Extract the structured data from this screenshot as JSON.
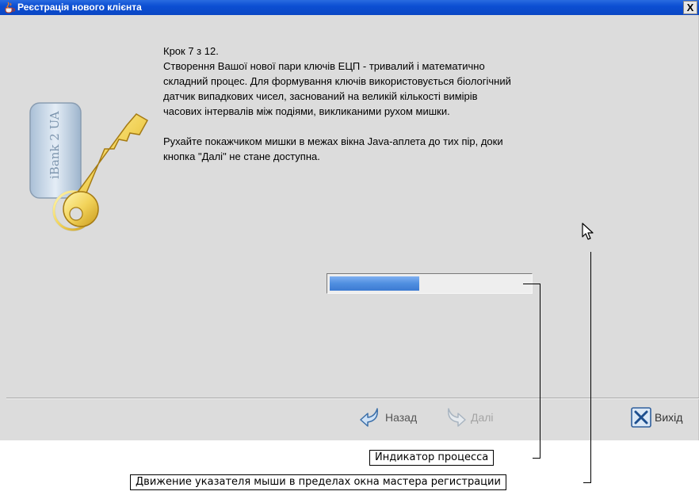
{
  "window": {
    "title": "Реєстрація нового клієнта",
    "close_label": "X"
  },
  "illustration": {
    "badge_text": "iBank 2 UA"
  },
  "instructions": {
    "line1": "Крок 7 з 12.",
    "line2": "Створення Вашої нової пари ключів ЕЦП - тривалий і математично",
    "line3": "складний процес. Для формування ключів використовується біологічний",
    "line4": "датчик випадкових чисел, заснований на великій кількості вимірів",
    "line5": "часових інтервалів між подіями, викликаними рухом мишки.",
    "line6": "Рухайте покажчиком мишки в межах вікна Java-аплета до тих пір, доки",
    "line7": "кнопка \"Далі\" не стане доступна."
  },
  "progress": {
    "fraction": 0.45
  },
  "buttons": {
    "back_label": "Назад",
    "next_label": "Далі",
    "exit_label": "Вихід"
  },
  "callouts": {
    "progress_label": "Индикатор процесса",
    "mouse_label": "Движение указателя мыши в пределах окна мастера регистрации"
  },
  "colors": {
    "titlebar": "#0c4fd3",
    "progress_fill": "#4f8ee0",
    "window_bg": "#dcdcdc"
  },
  "icons": [
    "java-cup-icon",
    "keys-icon",
    "mouse-cursor-icon",
    "back-arrow-icon",
    "next-arrow-icon",
    "exit-x-icon"
  ]
}
